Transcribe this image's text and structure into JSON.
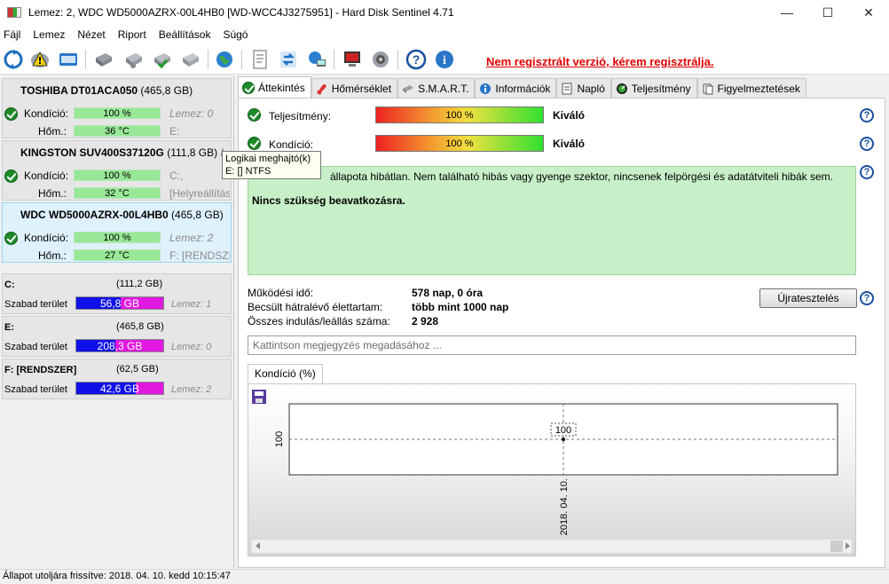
{
  "window": {
    "title": "Lemez: 2, WDC WD5000AZRX-00L4HB0 [WD-WCC4J3275951]  -  Hard Disk Sentinel 4.71",
    "minimize": "—",
    "maximize": "☐",
    "close": "✕"
  },
  "menu": [
    "Fájl",
    "Lemez",
    "Nézet",
    "Riport",
    "Beállítások",
    "Súgó"
  ],
  "toolbar": {
    "unregistered_text": "Nem regisztrált verzió, kérem regisztrálja."
  },
  "disks": [
    {
      "name": "TOSHIBA DT01ACA050",
      "size": "(465,8 GB)",
      "condition_label": "Kondíció:",
      "condition": "100 %",
      "condition_pct": 100,
      "temp_label": "Hőm.:",
      "temp": "36 °C",
      "side1": "Lemez: 0",
      "side2": "E:"
    },
    {
      "name": "KINGSTON SUV400S37120G",
      "size": "(111,8 GB)",
      "condition_label": "Kondíció:",
      "condition": "100 %",
      "condition_pct": 100,
      "temp_label": "Hőm.:",
      "temp": "32 °C",
      "side0": "L",
      "side1": "C:,",
      "side2": "[Helyreállítás"
    },
    {
      "name": "WDC WD5000AZRX-00L4HB0",
      "size": "(465,8 GB)",
      "condition_label": "Kondíció:",
      "condition": "100 %",
      "condition_pct": 100,
      "temp_label": "Hőm.:",
      "temp": "27 °C",
      "side1": "Lemez: 2",
      "side2": "F: [RENDSZER"
    }
  ],
  "volumes": [
    {
      "name": "C:",
      "size": "(111,2 GB)",
      "free_label": "Szabad terület",
      "free": "56,8 GB",
      "free_pct": 51,
      "disk": "Lemez: 1"
    },
    {
      "name": "E:",
      "size": "(465,8 GB)",
      "free_label": "Szabad terület",
      "free": "208,3 GB",
      "free_pct": 45,
      "disk": "Lemez: 0"
    },
    {
      "name": "F: [RENDSZER]",
      "size": "(62,5 GB)",
      "free_label": "Szabad terület",
      "free": "42,6 GB",
      "free_pct": 68,
      "disk": "Lemez: 2"
    }
  ],
  "tooltip": {
    "line1": "Logikai meghajtó(k)",
    "line2": "E: [] NTFS"
  },
  "tabs": [
    "Áttekintés",
    "Hőmérséklet",
    "S.M.A.R.T.",
    "Információk",
    "Napló",
    "Teljesítmény",
    "Figyelmeztetések"
  ],
  "overview": {
    "performance_label": "Teljesítmény:",
    "performance_value": "100 %",
    "performance_rating": "Kiváló",
    "condition_label": "Kondíció:",
    "condition_value": "100 %",
    "condition_rating": "Kiváló",
    "status_line1": "állapota hibátlan. Nem található hibás vagy gyenge szektor, nincsenek felpörgési és adatátviteli hibák sem.",
    "status_line2": "Nincs szükség beavatkozásra.",
    "uptime_label": "Működési idő:",
    "uptime_value": "578 nap, 0 óra",
    "lifetime_label": "Becsült hátralévő élettartam:",
    "lifetime_value": "több mint 1000 nap",
    "startstop_label": "Összes indulás/leállás száma:",
    "startstop_value": "2 928",
    "retest_button": "Újratesztelés",
    "note_placeholder": "Kattintson megjegyzés megadásához ...",
    "help": "?"
  },
  "chart_data": {
    "type": "line",
    "title": "Kondíció  (%)",
    "x": [
      "2018. 04. 10."
    ],
    "series": [
      {
        "values": [
          100
        ]
      }
    ],
    "y_tick_labels": [
      "100"
    ],
    "data_labels": [
      "100"
    ],
    "grid": true
  },
  "statusbar": {
    "text": "Állapot utoljára frissítve: 2018. 04. 10. kedd 10:15:47"
  }
}
